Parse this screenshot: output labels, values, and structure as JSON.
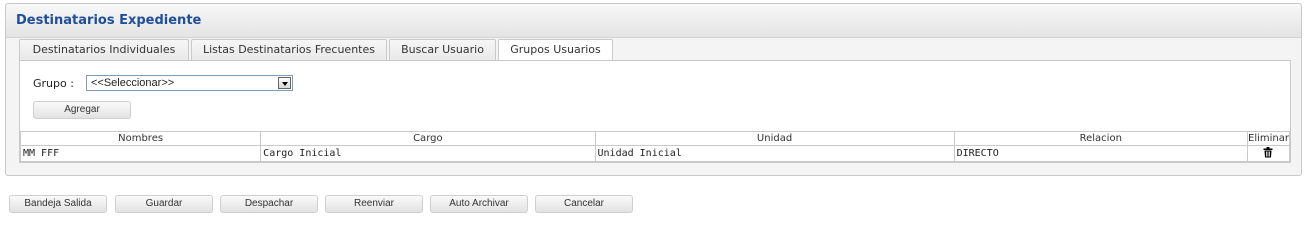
{
  "panel": {
    "title": "Destinatarios Expediente"
  },
  "tabs": [
    {
      "label": "Destinatarios Individuales",
      "active": false
    },
    {
      "label": "Listas Destinatarios Frecuentes",
      "active": false
    },
    {
      "label": "Buscar Usuario",
      "active": false
    },
    {
      "label": "Grupos Usuarios",
      "active": true
    }
  ],
  "form": {
    "grupo_label": "Grupo :",
    "grupo_selected": "<<Seleccionar>>",
    "agregar_label": "Agregar"
  },
  "table": {
    "headers": [
      "Nombres",
      "Cargo",
      "Unidad",
      "Relacion",
      "Eliminar"
    ],
    "rows": [
      {
        "nombres": "MM FFF",
        "cargo": "Cargo Inicial",
        "unidad": "Unidad Inicial",
        "relacion": "DIRECTO",
        "eliminar_icon": "trash-icon"
      }
    ]
  },
  "actions": [
    "Bandeja Salida",
    "Guardar",
    "Despachar",
    "Reenviar",
    "Auto Archivar",
    "Cancelar"
  ]
}
